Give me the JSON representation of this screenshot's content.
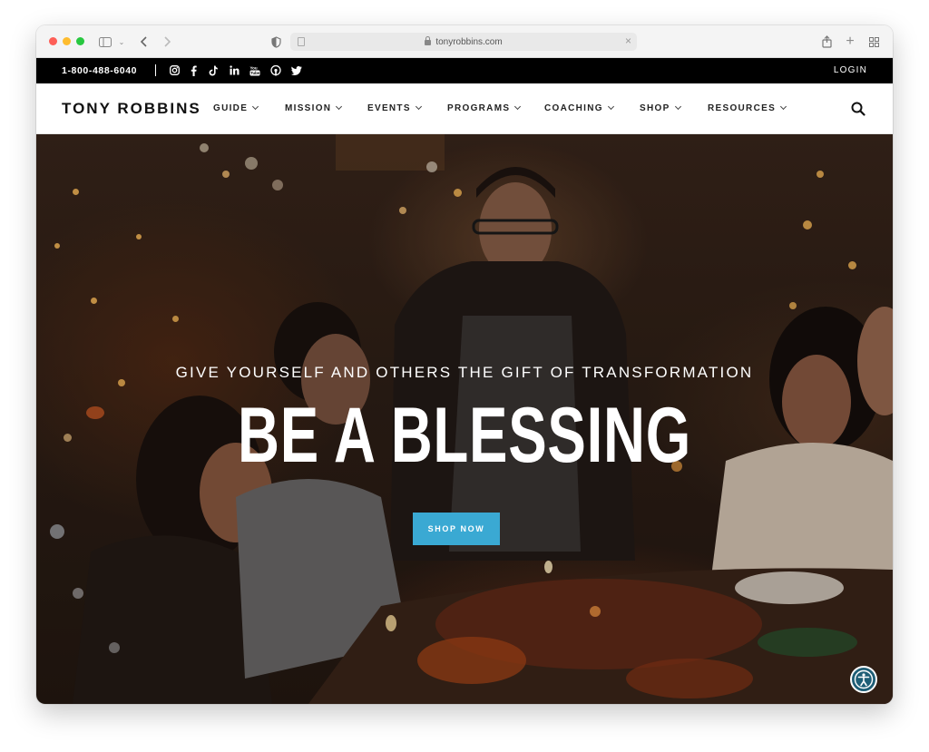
{
  "browser": {
    "url": "tonyrobbins.com",
    "icons": [
      "sidebar-icon",
      "chevron-down-icon",
      "back-icon",
      "forward-icon",
      "shield-icon",
      "share-icon",
      "new-tab-icon",
      "tab-overview-icon"
    ]
  },
  "topbar": {
    "phone": "1-800-488-6040",
    "social": [
      "instagram-icon",
      "facebook-icon",
      "tiktok-icon",
      "linkedin-icon",
      "youtube-icon",
      "podcast-icon",
      "twitter-icon"
    ],
    "login": "LOGIN"
  },
  "nav": {
    "logo": "TONY ROBBINS",
    "items": [
      {
        "label": "GUIDE"
      },
      {
        "label": "MISSION"
      },
      {
        "label": "EVENTS"
      },
      {
        "label": "PROGRAMS"
      },
      {
        "label": "COACHING"
      },
      {
        "label": "SHOP"
      },
      {
        "label": "RESOURCES"
      }
    ]
  },
  "hero": {
    "subtitle": "GIVE YOURSELF AND OTHERS THE GIFT OF TRANSFORMATION",
    "headline": "BE A BLESSING",
    "cta": "SHOP NOW"
  },
  "colors": {
    "accent": "#3aa9d3",
    "topbar": "#000000",
    "a11y": "#1e5e76"
  }
}
